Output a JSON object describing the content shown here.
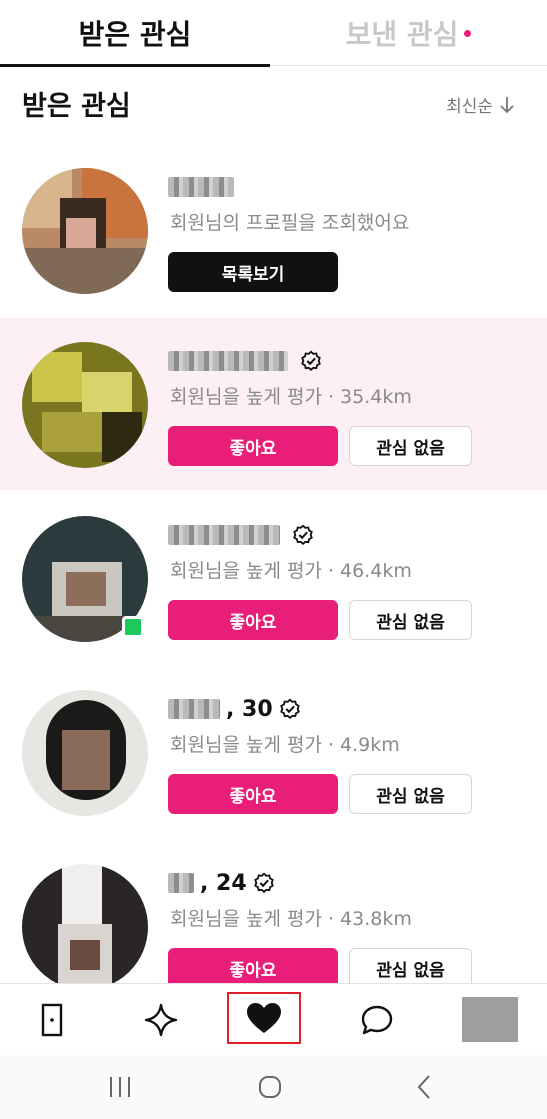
{
  "tabs": {
    "received": "받은 관심",
    "sent": "보낸 관심"
  },
  "section": {
    "title": "받은 관심",
    "sort_label": "최신순",
    "sort_icon": "arrow-down-icon"
  },
  "cards": [
    {
      "name_visible": "",
      "description": "회원님의 프로필을 조회했어요",
      "primary_button": "목록보기"
    },
    {
      "name_visible": "",
      "description": "회원님을 높게 평가 · 35.4km",
      "like_button": "좋아요",
      "pass_button": "관심 없음"
    },
    {
      "name_visible": "",
      "description": "회원님을 높게 평가 · 46.4km",
      "like_button": "좋아요",
      "pass_button": "관심 없음"
    },
    {
      "name_visible": ", 30",
      "description": "회원님을 높게 평가 · 4.9km",
      "like_button": "좋아요",
      "pass_button": "관심 없음"
    },
    {
      "name_visible": ", 24",
      "description": "회원님을 높게 평가 · 43.8km",
      "like_button": "좋아요",
      "pass_button": "관심 없음"
    }
  ],
  "bottom_nav": {
    "items": [
      "door-icon",
      "sparkle-icon",
      "heart-icon",
      "chat-bubble-icon",
      "profile-avatar"
    ],
    "active": "heart-icon"
  },
  "colors": {
    "accent": "#e91e78",
    "highlight_bg": "#fdf0f4",
    "dark_button": "#111111",
    "online": "#1dc95a",
    "focus_box": "#e0202a"
  }
}
